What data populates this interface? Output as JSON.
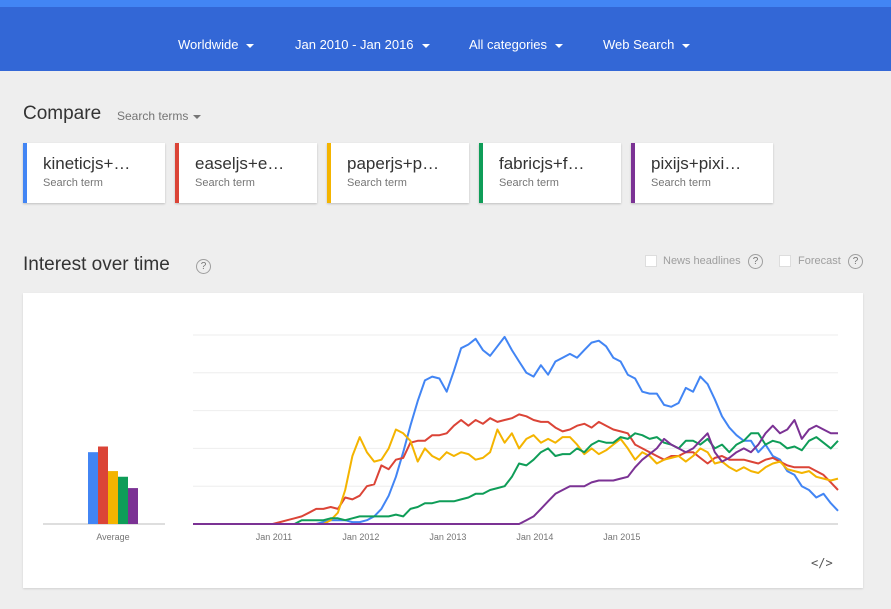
{
  "filters": [
    {
      "label": "Worldwide"
    },
    {
      "label": "Jan 2010 - Jan 2016"
    },
    {
      "label": "All categories"
    },
    {
      "label": "Web Search"
    }
  ],
  "compare": {
    "title": "Compare",
    "dropdown_label": "Search terms"
  },
  "terms": [
    {
      "name": "kineticjs+…",
      "type": "Search term",
      "color": "#4285f4"
    },
    {
      "name": "easeljs+e…",
      "type": "Search term",
      "color": "#db4437"
    },
    {
      "name": "paperjs+p…",
      "type": "Search term",
      "color": "#f4b400"
    },
    {
      "name": "fabricjs+f…",
      "type": "Search term",
      "color": "#0f9d58"
    },
    {
      "name": "pixijs+pixi…",
      "type": "Search term",
      "color": "#7b3294"
    }
  ],
  "interest": {
    "title": "Interest over time",
    "help": "?",
    "news_label": "News headlines",
    "forecast_label": "Forecast"
  },
  "chart_data": {
    "type": "line",
    "x_start": "2010-01",
    "x_end": "2015-12",
    "xticks": [
      "Jan 2011",
      "Jan 2012",
      "Jan 2013",
      "Jan 2014",
      "Jan 2015"
    ],
    "ylim": [
      0,
      100
    ],
    "grid": true,
    "average_label": "Average",
    "average": [
      38,
      41,
      28,
      25,
      19
    ],
    "series": [
      {
        "name": "kineticjs+…",
        "color": "#4285f4",
        "values": [
          0,
          0,
          0,
          0,
          0,
          0,
          0,
          0,
          0,
          0,
          0,
          0,
          0,
          0,
          0,
          0,
          0,
          0,
          1,
          2,
          2,
          2,
          1,
          1,
          2,
          4,
          8,
          15,
          25,
          38,
          52,
          65,
          76,
          78,
          77,
          70,
          81,
          93,
          95,
          98,
          92,
          89,
          94,
          99,
          92,
          86,
          80,
          78,
          84,
          79,
          86,
          88,
          90,
          88,
          92,
          96,
          97,
          94,
          88,
          86,
          79,
          77,
          70,
          69,
          69,
          63,
          62,
          64,
          72,
          70,
          78,
          74,
          66,
          57,
          51,
          47,
          44,
          44,
          38,
          42,
          36,
          34,
          28,
          26,
          20,
          18,
          14,
          16,
          11,
          7
        ],
        "_note": ""
      },
      {
        "name": "easeljs+e…",
        "color": "#db4437",
        "values": [
          0,
          0,
          0,
          0,
          0,
          0,
          0,
          0,
          0,
          0,
          0,
          0,
          1,
          2,
          3,
          4,
          6,
          8,
          8,
          9,
          8,
          14,
          13,
          15,
          20,
          21,
          31,
          29,
          34,
          35,
          43,
          44,
          44,
          47,
          47,
          48,
          52,
          55,
          52,
          55,
          53,
          56,
          54,
          55,
          56,
          58,
          57,
          55,
          54,
          54,
          51,
          49,
          50,
          52,
          53,
          51,
          54,
          52,
          50,
          49,
          48,
          42,
          40,
          38,
          36,
          34,
          36,
          36,
          38,
          38,
          35,
          32,
          35,
          36,
          34,
          34,
          34,
          33,
          32,
          34,
          35,
          33,
          31,
          30,
          30,
          30,
          28,
          26,
          22,
          18
        ],
        "_note": ""
      },
      {
        "name": "paperjs+p…",
        "color": "#f4b400",
        "values": [
          0,
          0,
          0,
          0,
          0,
          0,
          0,
          0,
          0,
          0,
          0,
          0,
          0,
          0,
          0,
          0,
          0,
          0,
          0,
          2,
          6,
          18,
          36,
          46,
          38,
          33,
          34,
          40,
          50,
          48,
          44,
          33,
          40,
          36,
          34,
          38,
          36,
          38,
          37,
          34,
          35,
          38,
          50,
          43,
          48,
          40,
          45,
          47,
          43,
          45,
          43,
          46,
          46,
          42,
          37,
          40,
          37,
          39,
          42,
          45,
          40,
          34,
          38,
          36,
          32,
          34,
          35,
          36,
          33,
          36,
          40,
          38,
          32,
          33,
          30,
          28,
          30,
          28,
          27,
          30,
          32,
          33,
          29,
          28,
          27,
          28,
          25,
          24,
          23,
          24
        ]
      },
      {
        "name": "fabricjs+f…",
        "color": "#0f9d58",
        "values": [
          0,
          0,
          0,
          0,
          0,
          0,
          0,
          0,
          0,
          0,
          0,
          0,
          0,
          0,
          0,
          2,
          2,
          2,
          2,
          3,
          3,
          2,
          3,
          4,
          4,
          4,
          4,
          4,
          5,
          4,
          8,
          9,
          11,
          11,
          12,
          12,
          12,
          13,
          14,
          16,
          16,
          18,
          19,
          20,
          25,
          32,
          31,
          34,
          38,
          40,
          36,
          37,
          37,
          40,
          38,
          42,
          44,
          43,
          43,
          46,
          45,
          48,
          47,
          45,
          46,
          43,
          42,
          40,
          44,
          44,
          42,
          45,
          40,
          42,
          38,
          42,
          44,
          48,
          48,
          42,
          44,
          43,
          40,
          41,
          39,
          44,
          46,
          43,
          40,
          44
        ]
      },
      {
        "name": "pixijs+pixi…",
        "color": "#7b3294",
        "values": [
          0,
          0,
          0,
          0,
          0,
          0,
          0,
          0,
          0,
          0,
          0,
          0,
          0,
          0,
          0,
          0,
          0,
          0,
          0,
          0,
          0,
          0,
          0,
          0,
          0,
          0,
          0,
          0,
          0,
          0,
          0,
          0,
          0,
          0,
          0,
          0,
          0,
          0,
          0,
          0,
          0,
          0,
          0,
          0,
          0,
          0,
          2,
          4,
          8,
          12,
          16,
          18,
          20,
          20,
          20,
          22,
          23,
          23,
          23,
          24,
          25,
          30,
          34,
          37,
          40,
          45,
          42,
          40,
          38,
          40,
          44,
          48,
          38,
          33,
          35,
          38,
          40,
          38,
          42,
          48,
          52,
          48,
          50,
          55,
          45,
          50,
          52,
          50,
          48,
          48
        ]
      }
    ]
  }
}
